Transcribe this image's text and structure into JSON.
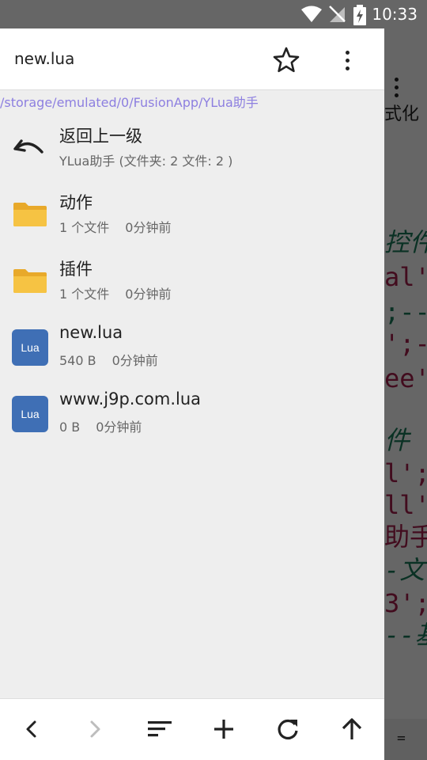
{
  "status_bar": {
    "time": "10:33"
  },
  "drawer": {
    "title": "new.lua",
    "path": "/storage/emulated/0/FusionApp/YLua助手",
    "items": [
      {
        "name": "返回上一级",
        "meta1": "YLua助手 (文件夹: 2 文件: 2 )",
        "meta2": "",
        "icon": "undo-icon"
      },
      {
        "name": "动作",
        "meta1": "1 个文件",
        "meta2": "0分钟前",
        "icon": "folder-icon"
      },
      {
        "name": "插件",
        "meta1": "1 个文件",
        "meta2": "0分钟前",
        "icon": "folder-icon"
      },
      {
        "name": "new.lua",
        "meta1": "540 B",
        "meta2": "0分钟前",
        "icon": "lua-file-icon",
        "badge": "Lua"
      },
      {
        "name": "www.j9p.com.lua",
        "meta1": "0 B",
        "meta2": "0分钟前",
        "icon": "lua-file-icon",
        "badge": "Lua"
      }
    ]
  },
  "background_editor": {
    "toolbar_label": "式化",
    "bottom_symbol": "=",
    "code_lines": [
      {
        "text": "控件",
        "color": "#1a7a5a",
        "italic": true
      },
      {
        "text": "al'",
        "color": "#a61e4d",
        "italic": false
      },
      {
        "text": ";--",
        "color": "#1a7a5a",
        "italic": false
      },
      {
        "text": "';-",
        "color": "#a61e4d",
        "italic": false
      },
      {
        "text": "ee'",
        "color": "#a61e4d",
        "italic": false
      },
      {
        "text": "",
        "color": "#222222",
        "italic": false
      },
      {
        "text": "件",
        "color": "#1a7a5a",
        "italic": true
      },
      {
        "text": "l';",
        "color": "#a61e4d",
        "italic": false
      },
      {
        "text": "ll'",
        "color": "#a61e4d",
        "italic": false
      },
      {
        "text": "助手",
        "color": "#a61e4d",
        "italic": false
      },
      {
        "text": "-文",
        "color": "#1a7a5a",
        "italic": true
      },
      {
        "text": "3';",
        "color": "#a61e4d",
        "italic": false
      },
      {
        "text": "--基",
        "color": "#1a7a5a",
        "italic": true
      }
    ]
  },
  "colors": {
    "path_text": "#8d7fe0",
    "folder": "#f6c343",
    "lua_badge": "#3f6fb5"
  }
}
